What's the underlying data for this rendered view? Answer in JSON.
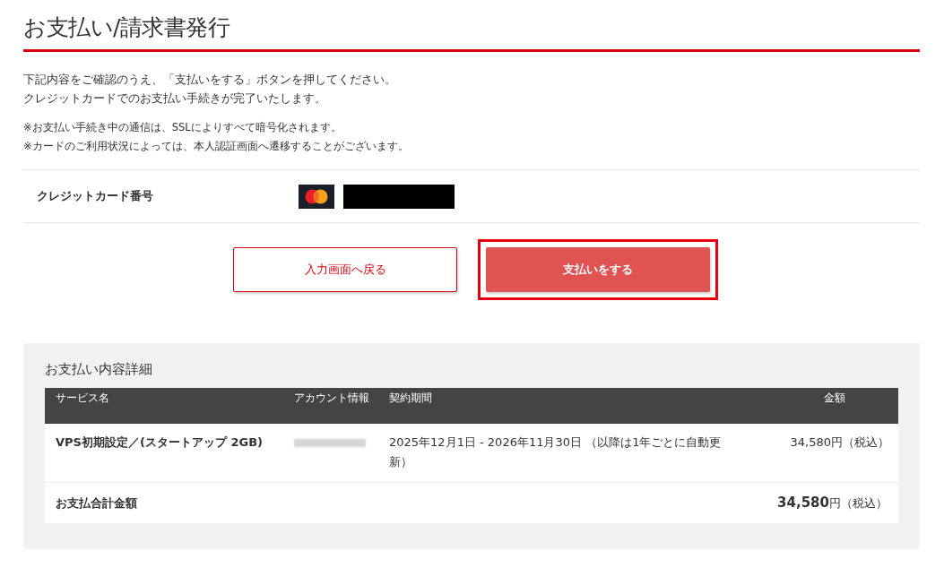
{
  "title": "お支払い/請求書発行",
  "intro": [
    "下記内容をご確認のうえ、「支払いをする」ボタンを押してください。",
    "クレジットカードでのお支払い手続きが完了いたします。"
  ],
  "notes": [
    "※お支払い手続き中の通信は、SSLによりすべて暗号化されます。",
    "※カードのご利用状況によっては、本人認証画面へ遷移することがございます。"
  ],
  "card": {
    "label": "クレジットカード番号",
    "redacted": true
  },
  "buttons": [
    {
      "label": "入力画面へ戻る",
      "kind": "outline",
      "highlighted": false
    },
    {
      "label": "支払いをする",
      "kind": "primary",
      "highlighted": true
    }
  ],
  "details": {
    "heading": "お支払い内容詳細",
    "columns": [
      "サービス名",
      "アカウント情報",
      "契約期間",
      "金額"
    ],
    "rows": [
      {
        "service": "VPS初期設定／(スタートアップ 2GB)",
        "account_redacted": true,
        "period": "2025年12月1日 - 2026年11月30日 （以降は1年ごとに自動更新）",
        "amount": "34,580円（税込）"
      }
    ],
    "total_label": "お支払合計金額",
    "total": "**34,580**円（税込）"
  }
}
